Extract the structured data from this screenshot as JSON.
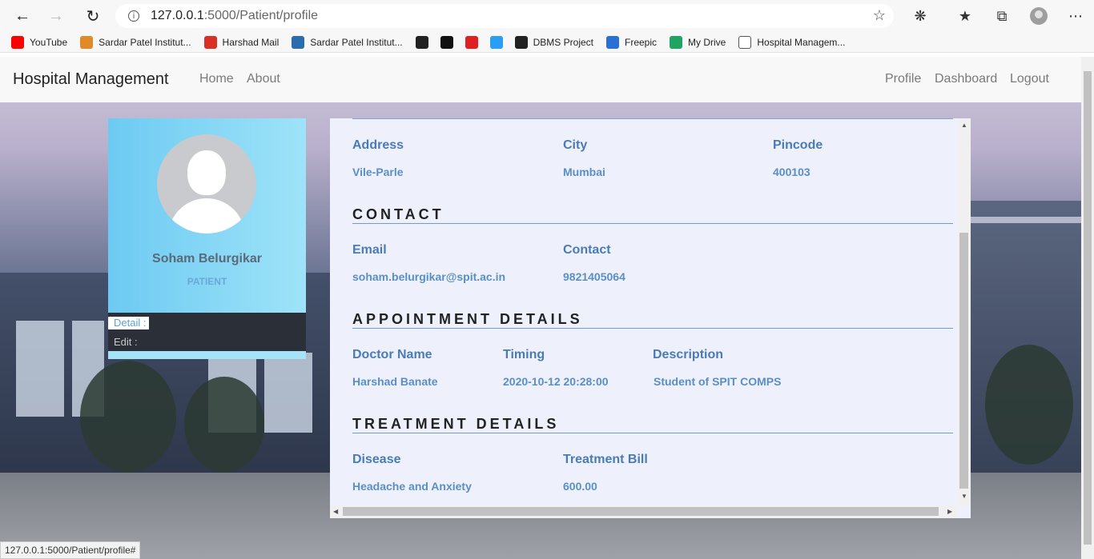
{
  "browser": {
    "url_host": "127.0.0.1",
    "url_path": ":5000/Patient/profile",
    "status_url": "127.0.0.1:5000/Patient/profile#"
  },
  "bookmarks": [
    {
      "label": "YouTube",
      "color": "#ff0000"
    },
    {
      "label": "Sardar Patel Institut...",
      "color": "#e08a2a"
    },
    {
      "label": "Harshad Mail",
      "color": "#d93025"
    },
    {
      "label": "Sardar Patel Institut...",
      "color": "#2b6cb0"
    },
    {
      "label": "",
      "color": "#222222"
    },
    {
      "label": "",
      "color": "#111111"
    },
    {
      "label": "",
      "color": "#e02020"
    },
    {
      "label": "",
      "color": "#2a9df4"
    },
    {
      "label": "DBMS Project",
      "color": "#222222"
    },
    {
      "label": "Freepic",
      "color": "#2a6fd6"
    },
    {
      "label": "My Drive",
      "color": "#1fa463"
    },
    {
      "label": "Hospital Managem...",
      "color": "#ffffff"
    }
  ],
  "navbar": {
    "brand": "Hospital Management",
    "left_links": [
      "Home",
      "About"
    ],
    "right_links": [
      "Profile",
      "Dashboard",
      "Logout"
    ]
  },
  "profile": {
    "name": "Soham Belurgikar",
    "role": "PATIENT",
    "menu": [
      "Detail :",
      "Edit :"
    ]
  },
  "details": {
    "address": {
      "label": "Address",
      "value": "Vile-Parle"
    },
    "city": {
      "label": "City",
      "value": "Mumbai"
    },
    "pincode": {
      "label": "Pincode",
      "value": "400103"
    },
    "contact_section": "CONTACT",
    "email": {
      "label": "Email",
      "value": "soham.belurgikar@spit.ac.in"
    },
    "contact": {
      "label": "Contact",
      "value": "9821405064"
    },
    "appointment_section": "APPOINTMENT DETAILS",
    "doctor": {
      "label": "Doctor Name",
      "value": "Harshad Banate"
    },
    "timing": {
      "label": "Timing",
      "value": "2020-10-12 20:28:00"
    },
    "description": {
      "label": "Description",
      "value": "Student of SPIT COMPS"
    },
    "treatment_section": "TREATMENT DETAILS",
    "disease": {
      "label": "Disease",
      "value": "Headache and Anxiety"
    },
    "bill": {
      "label": "Treatment Bill",
      "value": "600.00"
    }
  }
}
